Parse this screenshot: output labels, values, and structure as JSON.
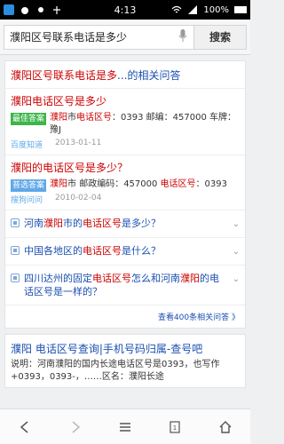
{
  "status": {
    "time": "4:13",
    "battery": "100%"
  },
  "search": {
    "query": "濮阳区号联系电话是多少",
    "button": "搜索"
  },
  "related": {
    "title_parts": [
      "濮阳区号联系电话是多",
      "...的相关问答"
    ],
    "answers": [
      {
        "question": "濮阳电话区号是多少",
        "badge": "最佳答案",
        "text_parts": [
          "濮阳",
          "市",
          "电话区号",
          "：0393 邮编：457000 车牌：豫J"
        ],
        "source": "百度知道",
        "date": "2013-01-11"
      },
      {
        "question": "濮阳的电话区号是多少？",
        "badge": "普选答案",
        "text_parts": [
          "濮阳",
          "市 邮政编码：457000 ",
          "电话区号",
          "：0393"
        ],
        "source": "搜狗问问",
        "date": "2010-02-04"
      }
    ],
    "questions": [
      {
        "parts": [
          "河南",
          "濮阳",
          "市的",
          "电话区号",
          "是多少？"
        ]
      },
      {
        "parts": [
          "中国各地区的",
          "电话区号",
          "是什么？"
        ]
      },
      {
        "parts": [
          "四川达州的固定",
          "电话区号",
          "怎么和河南",
          "濮阳",
          "的电话区号是一样的？"
        ]
      }
    ],
    "more": "查看400条相关问答 》"
  },
  "result2": {
    "title": "濮阳 电话区号查询|手机号码归属-查号吧",
    "desc": "说明：河南濮阳的国内长途电话区号是0393，也写作+0393，0393-，……区名：濮阳长途"
  }
}
